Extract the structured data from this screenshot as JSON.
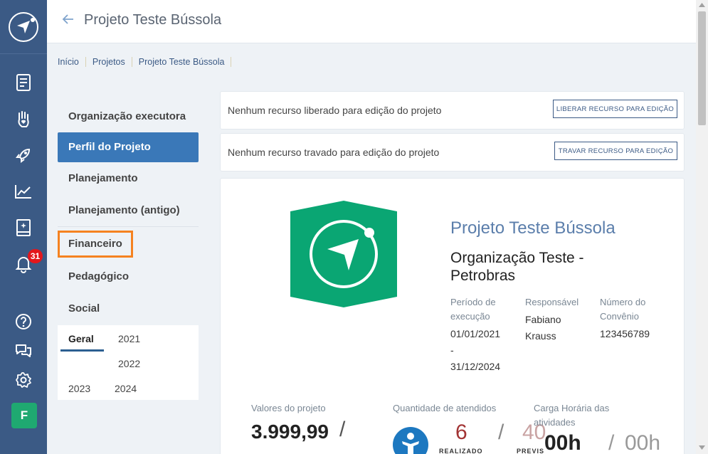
{
  "sidebar": {
    "icons": [
      "document-icon",
      "hand-heart-icon",
      "rocket-icon",
      "chart-line-icon",
      "book-icon",
      "bell-icon",
      "help-icon",
      "chat-icon",
      "gear-icon"
    ],
    "notification_count": "31",
    "avatar_letter": "F"
  },
  "header": {
    "title": "Projeto Teste Bússola"
  },
  "breadcrumb": [
    "Início",
    "Projetos",
    "Projeto Teste Bússola"
  ],
  "nav": {
    "items": [
      "Organização executora",
      "Perfil do Projeto",
      "Planejamento",
      "Planejamento (antigo)",
      "Financeiro",
      "Pedagógico",
      "Social"
    ],
    "active": "Perfil do Projeto",
    "highlighted": "Financeiro"
  },
  "subtabs": {
    "items": [
      "Geral",
      "2021",
      "2022",
      "2023",
      "2024"
    ],
    "selected": "Geral"
  },
  "notices": [
    {
      "text": "Nenhum recurso liberado para edição do projeto",
      "button": "LIBERAR RECURSO PARA EDIÇÃO"
    },
    {
      "text": "Nenhum recurso travado para edição do projeto",
      "button": "TRAVAR RECURSO PARA EDIÇÃO"
    }
  ],
  "project": {
    "name": "Projeto Teste Bússola",
    "organization": "Organização Teste - Petrobras",
    "period_label": "Período de execução",
    "period_start": "01/01/2021",
    "period_sep": "-",
    "period_end": "31/12/2024",
    "responsible_label": "Responsável",
    "responsible_value": "Fabiano Krauss",
    "agreement_label": "Número do Convênio",
    "agreement_value": "123456789"
  },
  "stats": {
    "values_label": "Valores do projeto",
    "values_amount": "3.999,99",
    "values_slash": "/",
    "attendees_label": "Quantidade de atendidos",
    "attendees_realized": "6",
    "attendees_realized_label": "REALIZADO",
    "attendees_slash": "/",
    "attendees_planned": "40",
    "attendees_planned_label": "PREVIS",
    "hours_label": "Carga Horária das atividades",
    "hours_realized": "00h",
    "hours_slash": "/",
    "hours_planned": "00h"
  },
  "colors": {
    "sidebar": "#3b5a85",
    "active_nav": "#3a78b8",
    "highlight": "#f58220",
    "brand_green": "#0aa673",
    "badge": "#e3171c",
    "accent_red": "#a23434"
  }
}
